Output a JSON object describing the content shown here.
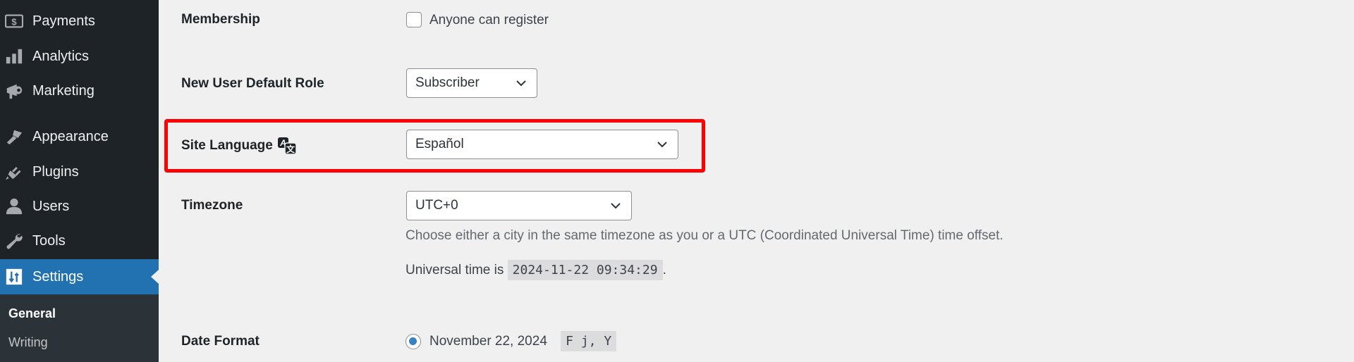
{
  "sidebar": {
    "items": [
      {
        "label": "Payments",
        "icon": "dollar-icon"
      },
      {
        "label": "Analytics",
        "icon": "bar-chart-icon"
      },
      {
        "label": "Marketing",
        "icon": "megaphone-icon"
      },
      {
        "label": "Appearance",
        "icon": "paintbrush-icon"
      },
      {
        "label": "Plugins",
        "icon": "plug-icon"
      },
      {
        "label": "Users",
        "icon": "user-icon"
      },
      {
        "label": "Tools",
        "icon": "wrench-icon"
      },
      {
        "label": "Settings",
        "icon": "settings-icon",
        "active": true
      }
    ],
    "submenu": [
      {
        "label": "General",
        "current": true
      },
      {
        "label": "Writing"
      }
    ]
  },
  "settings": {
    "membership": {
      "label": "Membership",
      "checkbox_label": "Anyone can register",
      "checked": false
    },
    "default_role": {
      "label": "New User Default Role",
      "value": "Subscriber"
    },
    "site_language": {
      "label": "Site Language",
      "value": "Español"
    },
    "timezone": {
      "label": "Timezone",
      "value": "UTC+0",
      "description": "Choose either a city in the same timezone as you or a UTC (Coordinated Universal Time) time offset.",
      "universal_prefix": "Universal time is",
      "universal_time": "2024-11-22 09:34:29",
      "universal_suffix": "."
    },
    "date_format": {
      "label": "Date Format",
      "option_label": "November 22, 2024",
      "format_code": "F j, Y",
      "selected": true
    }
  },
  "colors": {
    "accent": "#2271b1",
    "highlight": "#ff0000",
    "sidebar_bg": "#1d2327"
  }
}
